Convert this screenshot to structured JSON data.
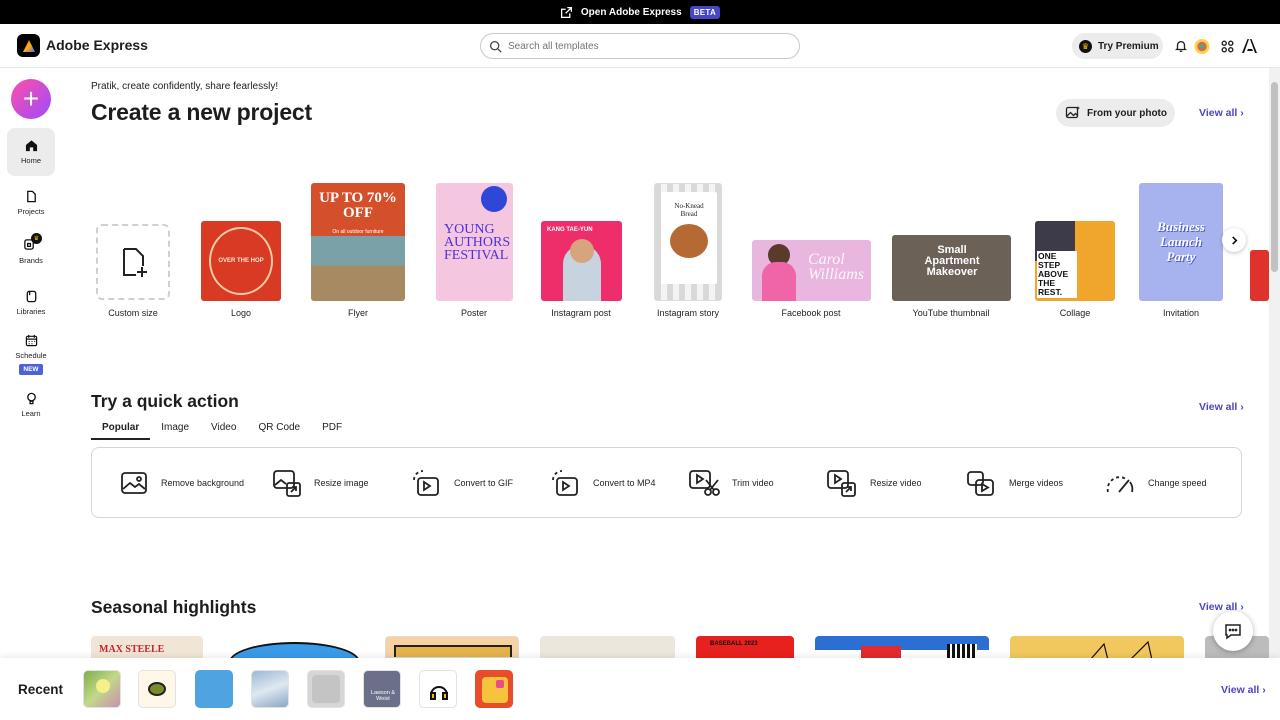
{
  "banner": {
    "text": "Open Adobe Express",
    "badge": "BETA"
  },
  "header": {
    "app_name": "Adobe Express",
    "search_placeholder": "Search all templates",
    "premium_label": "Try Premium"
  },
  "rail": {
    "items": [
      {
        "label": "Home"
      },
      {
        "label": "Projects"
      },
      {
        "label": "Brands"
      },
      {
        "label": "Libraries"
      },
      {
        "label": "Schedule",
        "badge": "NEW"
      },
      {
        "label": "Learn"
      }
    ]
  },
  "main": {
    "greeting": "Pratik, create confidently, share fearlessly!",
    "title": "Create a new project",
    "from_photo": "From your photo",
    "view_all": "View all",
    "templates": [
      {
        "label": "Custom size"
      },
      {
        "label": "Logo",
        "text": "OVER THE HOP"
      },
      {
        "label": "Flyer",
        "text": "UP TO 70% OFF",
        "sub": "On all outdoor furniture"
      },
      {
        "label": "Poster",
        "text": "YOUNG AUTHORS FESTIVAL"
      },
      {
        "label": "Instagram post",
        "text": "KANG TAE-YUN"
      },
      {
        "label": "Instagram story",
        "text": "No-Knead Bread"
      },
      {
        "label": "Facebook post",
        "text": "Carol Williams"
      },
      {
        "label": "YouTube thumbnail",
        "text": "Small Apartment Makeover"
      },
      {
        "label": "Collage",
        "text": "ONE STEP ABOVE THE REST."
      },
      {
        "label": "Invitation",
        "text": "Business Launch Party"
      }
    ]
  },
  "quick": {
    "title": "Try a quick action",
    "view_all": "View all",
    "tabs": [
      "Popular",
      "Image",
      "Video",
      "QR Code",
      "PDF"
    ],
    "actions": [
      {
        "label": "Remove background",
        "icon": "remove-background-icon"
      },
      {
        "label": "Resize image",
        "icon": "resize-image-icon"
      },
      {
        "label": "Convert to GIF",
        "icon": "convert-gif-icon"
      },
      {
        "label": "Convert to MP4",
        "icon": "convert-mp4-icon"
      },
      {
        "label": "Trim video",
        "icon": "trim-video-icon"
      },
      {
        "label": "Resize video",
        "icon": "resize-video-icon"
      },
      {
        "label": "Merge videos",
        "icon": "merge-videos-icon"
      },
      {
        "label": "Change speed",
        "icon": "change-speed-icon"
      }
    ]
  },
  "seasonal": {
    "title": "Seasonal highlights",
    "view_all": "View all",
    "cards": [
      {
        "text": "MAX STEELE"
      },
      {
        "text": ""
      },
      {
        "text": ""
      },
      {
        "text": ""
      },
      {
        "text": "BASEBALL 2023"
      },
      {
        "text": ""
      },
      {
        "text": ""
      },
      {
        "text": ""
      }
    ]
  },
  "recent": {
    "label": "Recent",
    "view_all": "View all",
    "thumb_text": "Lawson & Weist"
  },
  "colors": {
    "accent": "#4b45c6",
    "banner": "#000000",
    "fab_start": "#ff4fa6",
    "fab_end": "#9e4bff"
  }
}
